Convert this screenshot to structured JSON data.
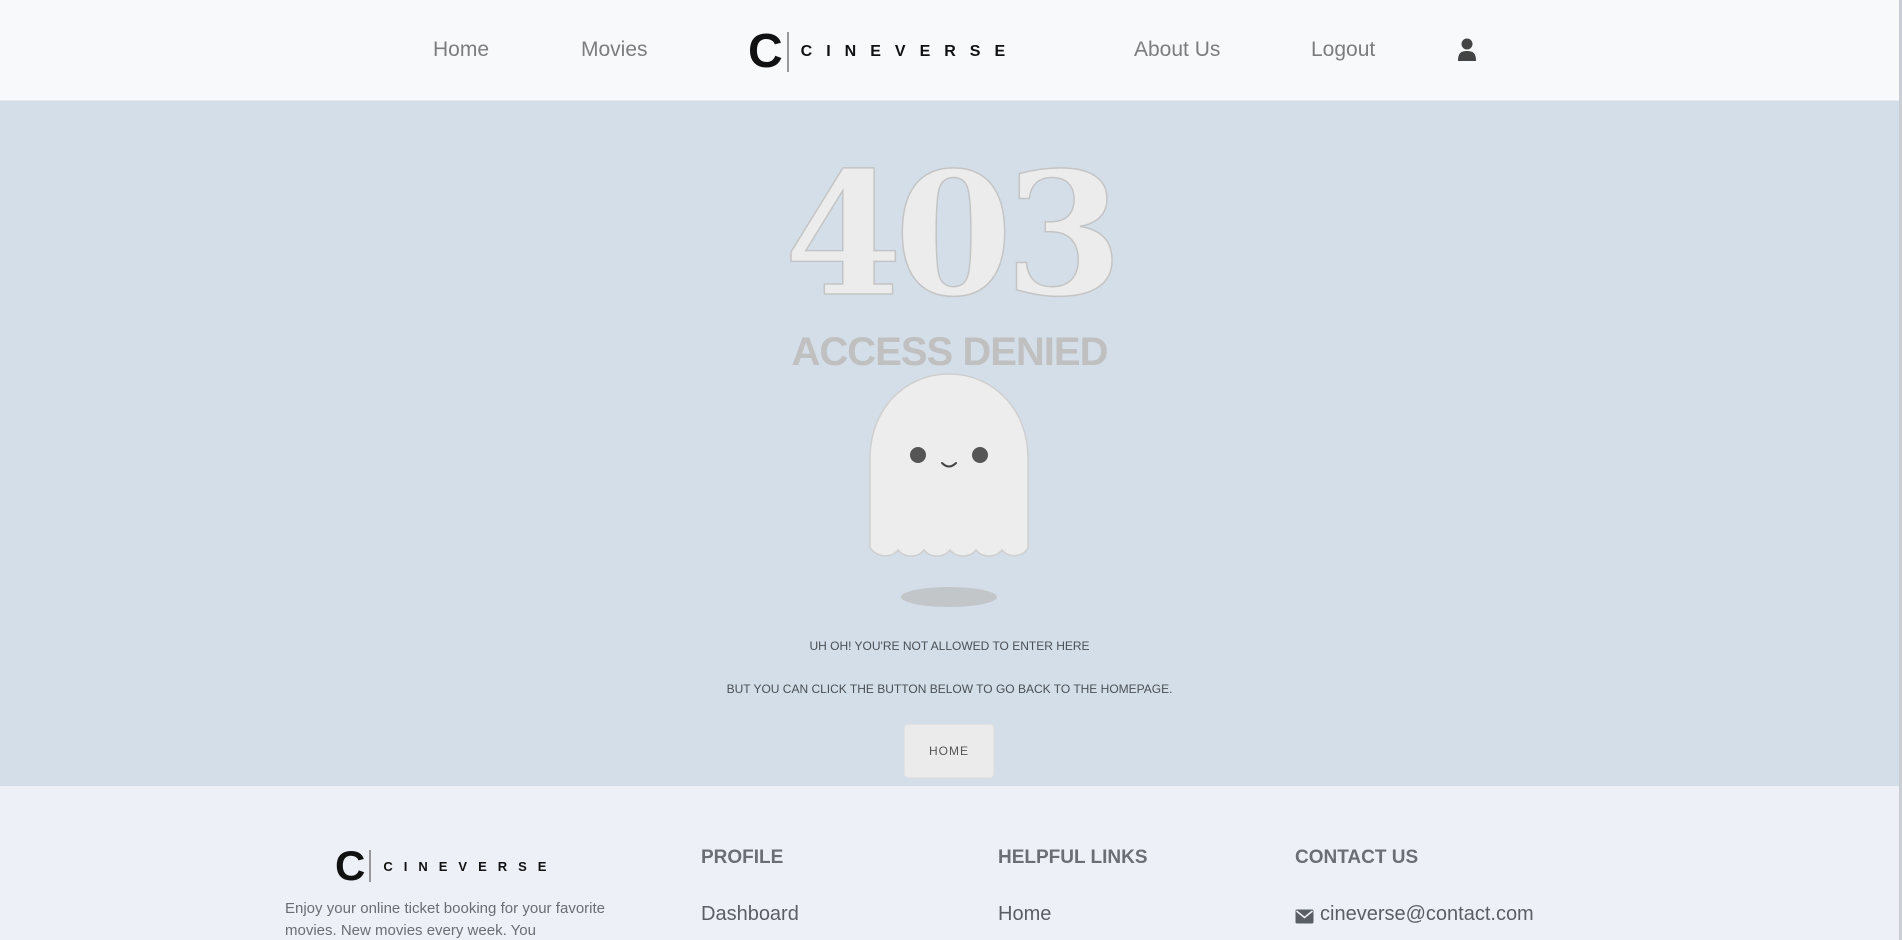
{
  "nav": {
    "home": "Home",
    "movies": "Movies",
    "about": "About Us",
    "logout": "Logout",
    "logo_letter": "C",
    "logo_word": "CINEVERSE",
    "user_icon": "user-icon"
  },
  "error": {
    "code": "403",
    "title": "ACCESS DENIED",
    "message1": "UH OH! YOU'RE NOT ALLOWED TO ENTER HERE",
    "message2": "BUT YOU CAN CLICK THE BUTTON BELOW TO GO BACK TO THE HOMEPAGE.",
    "button": "HOME"
  },
  "footer": {
    "logo_letter": "C",
    "logo_word": "CINEVERSE",
    "about_text": "Enjoy your online ticket booking for your favorite movies. New movies every week. You",
    "profile_title": "PROFILE",
    "profile_link": "Dashboard",
    "links_title": "HELPFUL LINKS",
    "links_home": "Home",
    "contact_title": "CONTACT US",
    "contact_email": "cineverse@contact.com",
    "mail_icon": "envelope-icon"
  },
  "colors": {
    "background": "#d4dee8",
    "navbar": "#f7f9fb",
    "footer": "#eef0f8"
  }
}
